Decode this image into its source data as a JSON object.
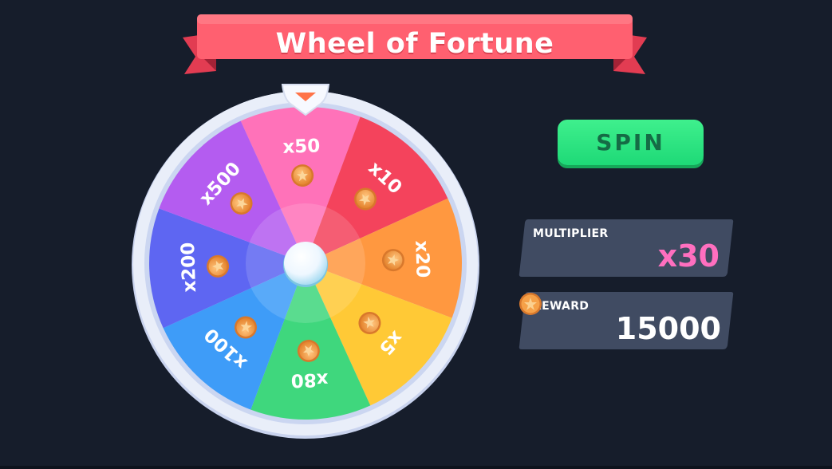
{
  "game": {
    "title": "Wheel of Fortune",
    "spin_label": "SPIN"
  },
  "wheel": {
    "segments": [
      {
        "label": "x50",
        "color": "#ff72b9"
      },
      {
        "label": "x10",
        "color": "#f4435c"
      },
      {
        "label": "x20",
        "color": "#ff9840"
      },
      {
        "label": "x5",
        "color": "#ffc936"
      },
      {
        "label": "x80",
        "color": "#3fd77d"
      },
      {
        "label": "x100",
        "color": "#3e9cf8"
      },
      {
        "label": "x200",
        "color": "#5e66f2"
      },
      {
        "label": "x500",
        "color": "#b45cf0"
      }
    ],
    "pointer_color": "#ff7348",
    "rim_color": "#d4def4"
  },
  "multiplier": {
    "label": "MULTIPLIER",
    "value": "x30"
  },
  "reward": {
    "label": "REWARD",
    "value": "15000"
  },
  "colors": {
    "background": "#161d2b",
    "ribbon": "#ff5f6d",
    "spin_button": "#2be583",
    "panel": "#3f4a61",
    "coin": "#f29a3c"
  }
}
